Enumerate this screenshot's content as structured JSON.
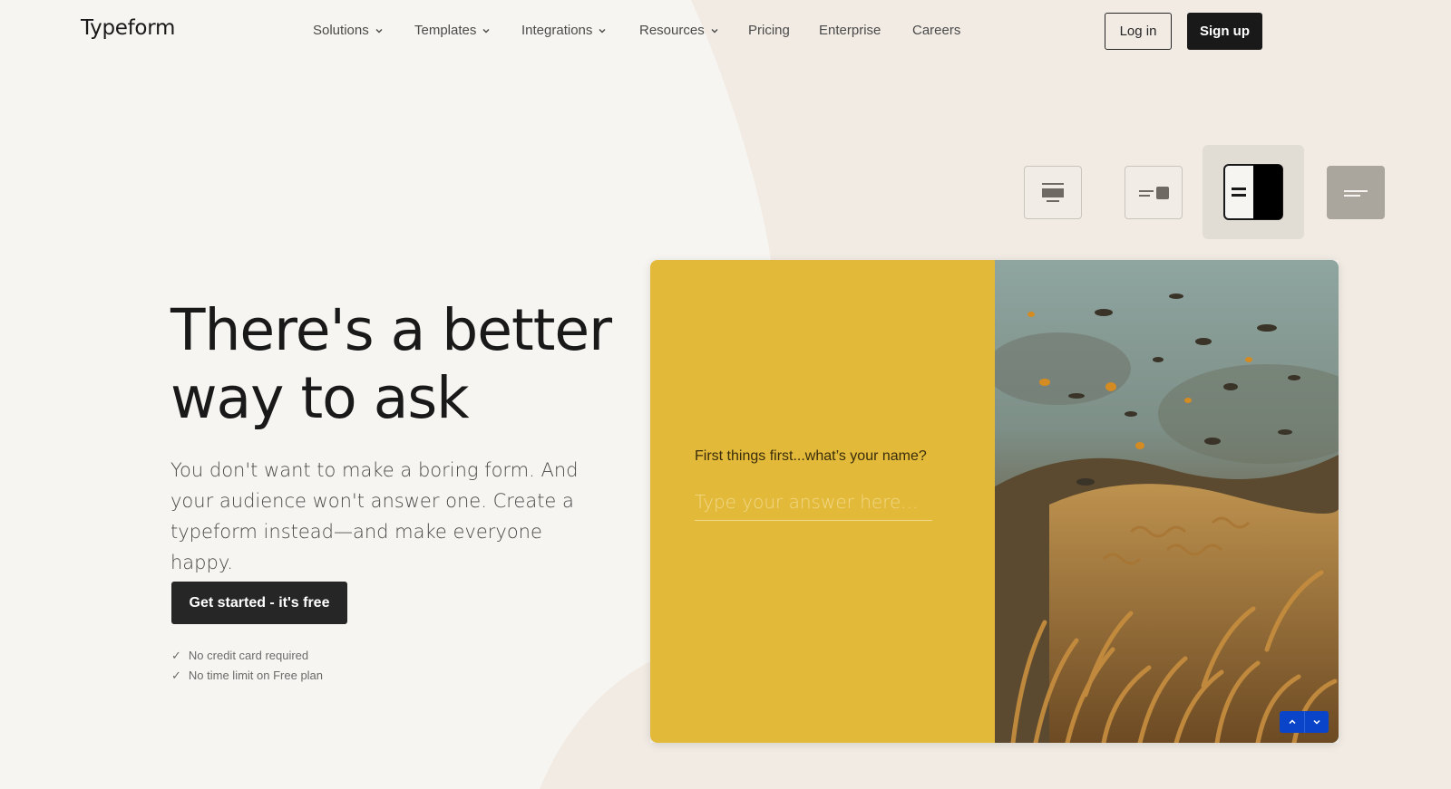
{
  "brand": {
    "logo_text": "Typeform"
  },
  "nav": {
    "items": [
      {
        "label": "Solutions",
        "has_dropdown": true
      },
      {
        "label": "Templates",
        "has_dropdown": true
      },
      {
        "label": "Integrations",
        "has_dropdown": true
      },
      {
        "label": "Resources",
        "has_dropdown": true
      },
      {
        "label": "Pricing",
        "has_dropdown": false
      },
      {
        "label": "Enterprise",
        "has_dropdown": false
      },
      {
        "label": "Careers",
        "has_dropdown": false
      }
    ],
    "login_label": "Log in",
    "signup_label": "Sign up"
  },
  "layout_picker": {
    "options": [
      "layout-stack-icon",
      "layout-split-small-icon",
      "layout-split-half-icon",
      "layout-text-only-icon"
    ],
    "selected_index": 2
  },
  "hero": {
    "title": "There's a better way to ask",
    "subtitle": "You don't want to make a boring form. And your audience won't answer one. Create a typeform instead—and make everyone happy.",
    "cta_label": "Get started - it's free",
    "checks": [
      "No credit card required",
      "No time limit on Free plan"
    ],
    "check_glyph": "✓"
  },
  "preview": {
    "question": "First things first...what’s your name?",
    "answer_placeholder": "Type your answer here...",
    "image_subject": "coral reef with fish",
    "accent_color": "#e3b93a",
    "nav_button_color": "#0a45c9"
  },
  "colors": {
    "page_bg": "#f7f5f1",
    "shape_bg": "#f1ebe4",
    "dark_button": "#191919"
  }
}
